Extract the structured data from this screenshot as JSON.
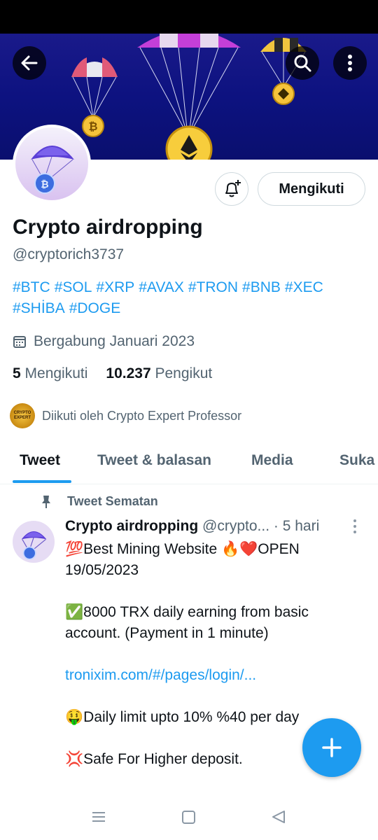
{
  "profile": {
    "name": "Crypto airdropping",
    "handle": "@cryptorich3737",
    "bio_tags": [
      "#BTC",
      "#SOL",
      "#XRP",
      "#AVAX",
      "#TRON",
      "#BNB",
      "#XEC",
      "#SHİBA",
      "#DOGE"
    ],
    "joined": "Bergabung Januari 2023",
    "following_count": "5",
    "following_label": "Mengikuti",
    "followers_count": "10.237",
    "followers_label": "Pengikut",
    "followed_by": "Diikuti oleh Crypto Expert Professor",
    "followed_by_avatar_text": "CRYPTO EXPERT"
  },
  "actions": {
    "follow_label": "Mengikuti"
  },
  "tabs": [
    {
      "label": "Tweet",
      "active": true
    },
    {
      "label": "Tweet & balasan",
      "active": false
    },
    {
      "label": "Media",
      "active": false
    },
    {
      "label": "Suka",
      "active": false
    }
  ],
  "pinned_label": "Tweet Sematan",
  "tweet": {
    "author": "Crypto airdropping",
    "handle_trunc": "@crypto...",
    "time": "· 5 hari",
    "lines": [
      "💯Best Mining Website 🔥❤️OPEN 19/05/2023",
      "✅8000 TRX daily earning from basic account. (Payment in 1 minute)",
      "tronixim.com/#/pages/login/...",
      "🤑Daily limit upto 10% %40 per day",
      "💢Safe For Higher deposit."
    ]
  },
  "icons": {
    "back": "arrow-left-icon",
    "search": "search-icon",
    "more": "more-vertical-icon",
    "bell": "bell-plus-icon",
    "calendar": "calendar-icon",
    "pin": "pin-icon",
    "compose": "plus-icon"
  },
  "colors": {
    "accent": "#1d9bf0",
    "text": "#0f1419",
    "muted": "#536471",
    "banner": "#0d1280"
  }
}
